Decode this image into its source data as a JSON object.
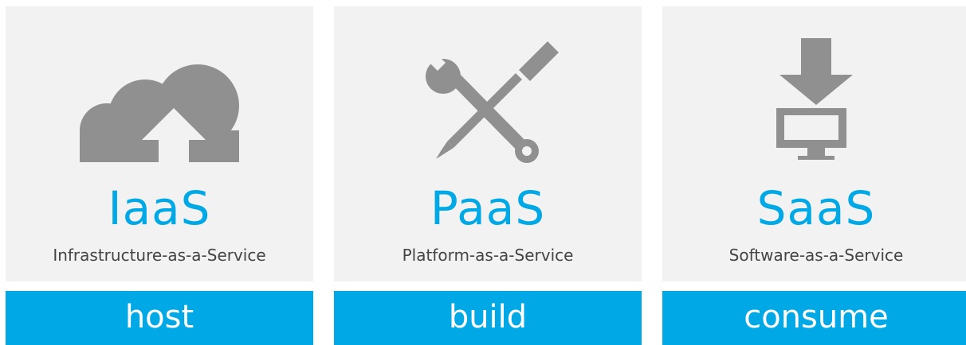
{
  "theme": {
    "accent": "#00a9e6",
    "card_bg": "#f2f2f2",
    "icon_gray": "#909090",
    "subtitle_color": "#444444",
    "bar_text": "#ffffff"
  },
  "columns": [
    {
      "icon": "cloud-upload-icon",
      "acronym": "IaaS",
      "full_name": "Infrastructure-as-a-Service",
      "action": "host"
    },
    {
      "icon": "wrench-screwdriver-icon",
      "acronym": "PaaS",
      "full_name": "Platform-as-a-Service",
      "action": "build"
    },
    {
      "icon": "download-monitor-icon",
      "acronym": "SaaS",
      "full_name": "Software-as-a-Service",
      "action": "consume"
    }
  ]
}
